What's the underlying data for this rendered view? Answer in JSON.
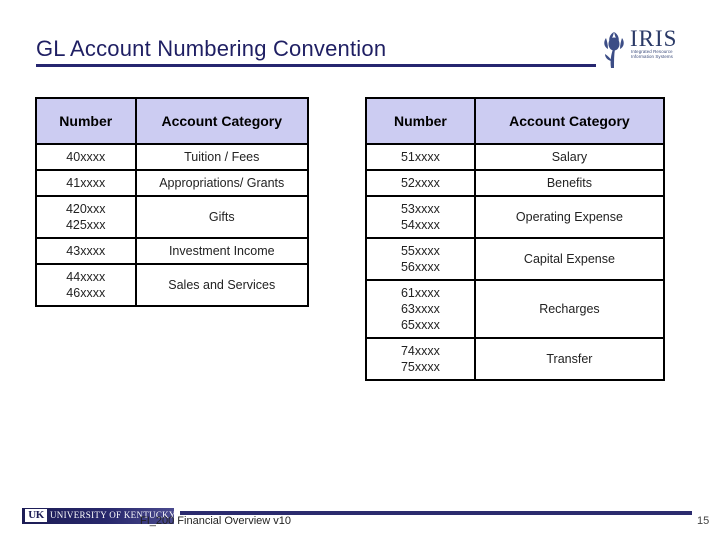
{
  "slide": {
    "title": "GL Account Numbering Convention",
    "page_number": "15",
    "footer_text": "FI_200 Financial Overview v10"
  },
  "iris_logo": {
    "wordmark": "IRIS",
    "subtitle": "Integrated Resource Information Systems",
    "icon": "iris-flower-icon",
    "color": "#2b3a67"
  },
  "uk_logo": {
    "mark": "UK",
    "wordmark": "UNIVERSITY OF KENTUCKY",
    "color": "#1d1d55"
  },
  "colors": {
    "title": "#1f1f63",
    "rule": "#262670",
    "header_fill": "#ccccf2",
    "border": "#000000"
  },
  "tables": {
    "revenue": {
      "name": "revenue-accounts-table",
      "headers": [
        "Number",
        "Account Category"
      ],
      "rows": [
        {
          "number": "40xxxx",
          "category": "Tuition / Fees"
        },
        {
          "number": "41xxxx",
          "category": "Appropriations/ Grants"
        },
        {
          "number": "420xxx\n425xxx",
          "category": "Gifts"
        },
        {
          "number": "43xxxx",
          "category": "Investment Income"
        },
        {
          "number": "44xxxx\n46xxxx",
          "category": "Sales and Services"
        }
      ]
    },
    "expense": {
      "name": "expense-accounts-table",
      "headers": [
        "Number",
        "Account Category"
      ],
      "rows": [
        {
          "number": "51xxxx",
          "category": "Salary"
        },
        {
          "number": "52xxxx",
          "category": "Benefits"
        },
        {
          "number": "53xxxx\n54xxxx",
          "category": "Operating Expense"
        },
        {
          "number": "55xxxx\n56xxxx",
          "category": "Capital Expense"
        },
        {
          "number": "61xxxx\n63xxxx\n65xxxx",
          "category": "Recharges"
        },
        {
          "number": "74xxxx\n75xxxx",
          "category": "Transfer"
        }
      ]
    }
  }
}
